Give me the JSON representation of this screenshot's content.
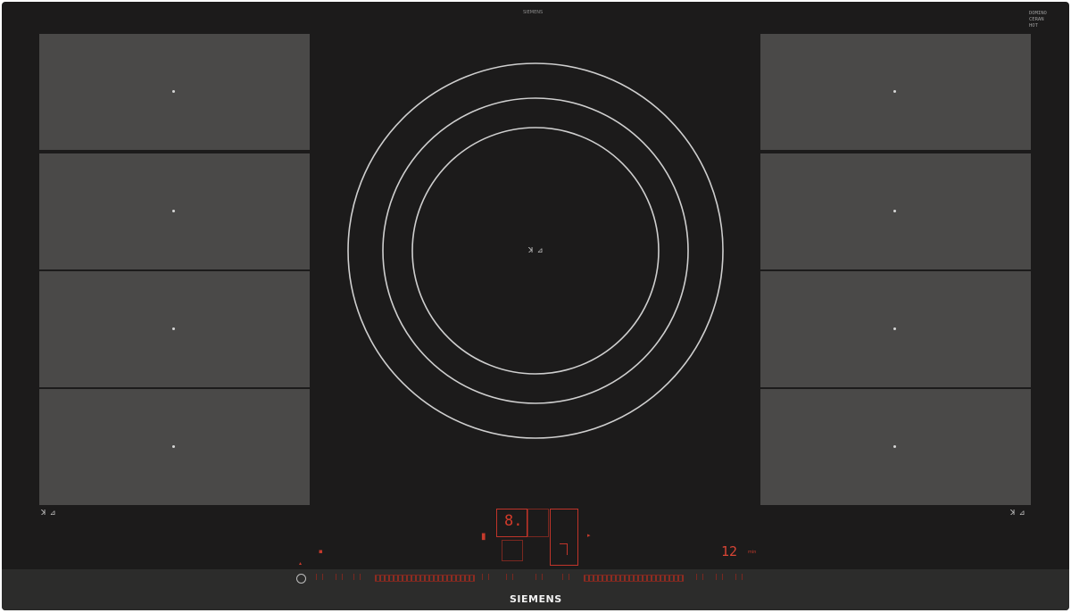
{
  "hob": {
    "top_label": "SIEMENS",
    "badge_lines": [
      "DOMINO",
      "CERAN",
      "HOT"
    ],
    "brand": "SIEMENS",
    "flex_icon_text": "ꓘ ⊿",
    "display_main": "8.",
    "display_timer": "12",
    "timer_unit": "min",
    "colors": {
      "glass": "#1c1b1b",
      "zone": "#4a4948",
      "ring": "#cfcfcf",
      "control_red": "#d23a2a"
    }
  }
}
